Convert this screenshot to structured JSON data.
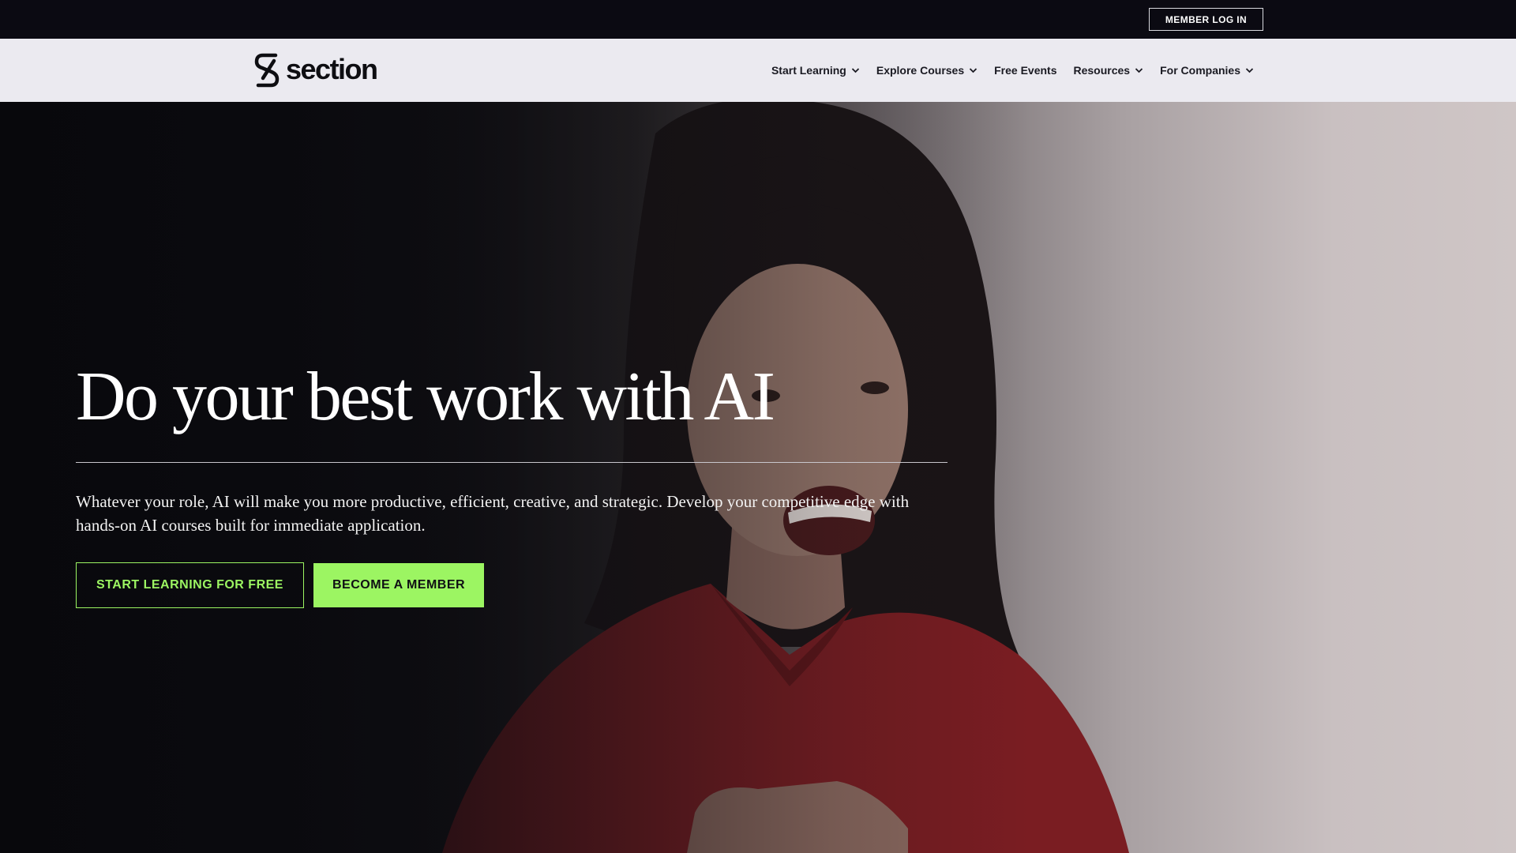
{
  "topbar": {
    "login_label": "MEMBER LOG IN"
  },
  "brand": {
    "name": "section",
    "logo_icon": "section-s-logo-icon"
  },
  "nav": {
    "items": [
      {
        "label": "Start Learning",
        "has_dropdown": true
      },
      {
        "label": "Explore Courses",
        "has_dropdown": true
      },
      {
        "label": "Free Events",
        "has_dropdown": false
      },
      {
        "label": "Resources",
        "has_dropdown": true
      },
      {
        "label": "For Companies",
        "has_dropdown": true
      }
    ],
    "dropdown_icon": "chevron-down-icon"
  },
  "hero": {
    "title": "Do your best work with AI",
    "subtitle": "Whatever your role, AI will make you more productive, efficient, creative, and strategic. Develop your competitive edge with hands-on AI courses built for immediate application.",
    "cta_primary": "START LEARNING FOR FREE",
    "cta_secondary": "BECOME A MEMBER",
    "background": "video still of a smiling woman with dark hair in a red top, hand on chest"
  },
  "colors": {
    "accent_green": "#9cf562",
    "topbar_bg": "#0b0a12",
    "nav_bg": "#ebeaf0",
    "hero_dark": "#0c0b0f"
  }
}
